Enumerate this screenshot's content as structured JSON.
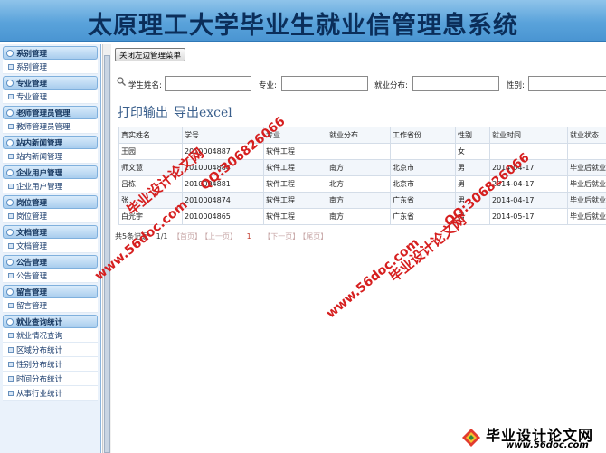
{
  "header": {
    "title": "太原理工大学毕业生就业信管理息系统"
  },
  "sidebar": {
    "groups": [
      {
        "title": "系别管理",
        "items": [
          "系别管理"
        ]
      },
      {
        "title": "专业管理",
        "items": [
          "专业管理"
        ]
      },
      {
        "title": "老师管理员管理",
        "items": [
          "教师管理员管理"
        ]
      },
      {
        "title": "站内新闻管理",
        "items": [
          "站内新闻管理"
        ]
      },
      {
        "title": "企业用户管理",
        "items": [
          "企业用户管理"
        ]
      },
      {
        "title": "岗位管理",
        "items": [
          "岗位管理"
        ]
      },
      {
        "title": "文档管理",
        "items": [
          "文档管理"
        ]
      },
      {
        "title": "公告管理",
        "items": [
          "公告管理"
        ]
      },
      {
        "title": "留言管理",
        "items": [
          "留言管理"
        ]
      },
      {
        "title": "就业查询统计",
        "items": [
          "就业情况查询",
          "区域分布统计",
          "性别分布统计",
          "时间分布统计",
          "从事行业统计"
        ]
      }
    ]
  },
  "main": {
    "toggle_button": "关闭左边管理菜单",
    "search": {
      "name_label": "学生姓名:",
      "major_label": "专业:",
      "distribution_label": "就业分布:",
      "gender_label": "性别:"
    },
    "actions": {
      "print": "打印输出",
      "export": "导出excel"
    },
    "table": {
      "headers": [
        "真实姓名",
        "学号",
        "专业",
        "就业分布",
        "工作省份",
        "性别",
        "就业时间",
        "就业状态"
      ],
      "rows": [
        [
          "王园",
          "2010004887",
          "软件工程",
          "",
          "",
          "女",
          "",
          ""
        ],
        [
          "师文慧",
          "2010004884",
          "软件工程",
          "南方",
          "北京市",
          "男",
          "2014-04-17",
          "毕业后就业"
        ],
        [
          "吕栋",
          "2010004881",
          "软件工程",
          "北方",
          "北京市",
          "男",
          "2014-04-17",
          "毕业后就业"
        ],
        [
          "张",
          "2010004874",
          "软件工程",
          "南方",
          "广东省",
          "男",
          "2014-04-17",
          "毕业后就业"
        ],
        [
          "白光宇",
          "2010004865",
          "软件工程",
          "南方",
          "广东省",
          "男",
          "2014-05-17",
          "毕业后就业"
        ]
      ]
    },
    "pager": {
      "summary": "共5条记录",
      "pages": "1/1",
      "first": "【首页】",
      "prev": "【上一页】",
      "current": "1",
      "next": "【下一页】",
      "last": "【尾页】"
    }
  },
  "watermarks": {
    "site_cn": "毕业设计论文网",
    "site_url": "www.56doc.com",
    "qq": "QQ:306826066"
  },
  "logo": {
    "name": "毕业设计论文网",
    "url": "www.56doc.com"
  },
  "colors": {
    "banner": "#5aa3db",
    "title": "#0b2e5a",
    "watermark": "#d61f1f",
    "link": "#3a5f8c"
  }
}
